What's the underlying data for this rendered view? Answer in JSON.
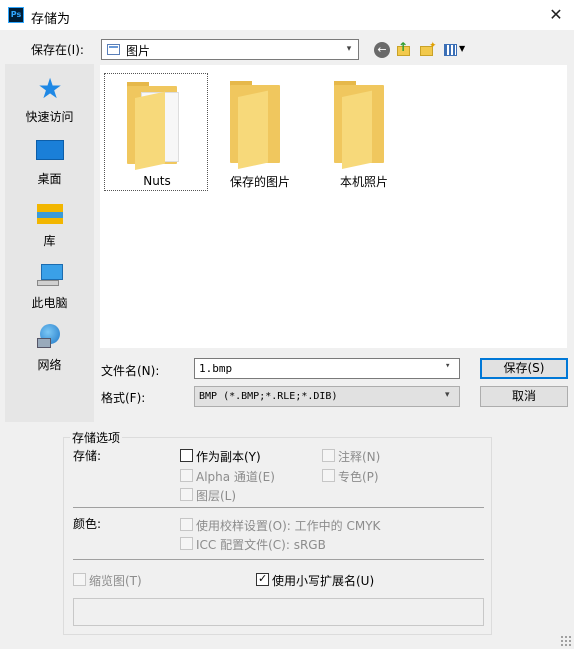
{
  "window": {
    "title": "存储为",
    "app_icon_text": "Ps",
    "close_glyph": "✕"
  },
  "toolbar": {
    "save_in_label": "保存在(I):",
    "save_in_value": "图片",
    "back_glyph": "←",
    "up_glyph": "↑",
    "new_folder_glyph": "✦",
    "view_dropdown_glyph": "▼"
  },
  "places": [
    {
      "label": "快速访问",
      "icon": "star-icon"
    },
    {
      "label": "桌面",
      "icon": "desktop-icon"
    },
    {
      "label": "库",
      "icon": "library-icon"
    },
    {
      "label": "此电脑",
      "icon": "computer-icon"
    },
    {
      "label": "网络",
      "icon": "network-icon"
    }
  ],
  "files": [
    {
      "name": "Nuts",
      "selected": true,
      "has_document": true
    },
    {
      "name": "保存的图片",
      "selected": false,
      "has_document": false
    },
    {
      "name": "本机照片",
      "selected": false,
      "has_document": false
    }
  ],
  "filename": {
    "label": "文件名(N):",
    "value": "1.bmp"
  },
  "format": {
    "label": "格式(F):",
    "value": "BMP (*.BMP;*.RLE;*.DIB)"
  },
  "buttons": {
    "save": "保存(S)",
    "cancel": "取消"
  },
  "save_options": {
    "title": "存储选项",
    "storage_label": "存储:",
    "as_copy": "作为副本(Y)",
    "notes": "注释(N)",
    "alpha": "Alpha 通道(E)",
    "spot": "专色(P)",
    "layers": "图层(L)",
    "color_label": "颜色:",
    "proof": "使用校样设置(O):  工作中的 CMYK",
    "icc": "ICC 配置文件(C):  sRGB",
    "thumbnail": "缩览图(T)",
    "lowercase_ext": "使用小写扩展名(U)"
  },
  "chevron_glyph": "▾",
  "colors": {
    "accent": "#0078d7",
    "folder": "#f0c75e"
  }
}
